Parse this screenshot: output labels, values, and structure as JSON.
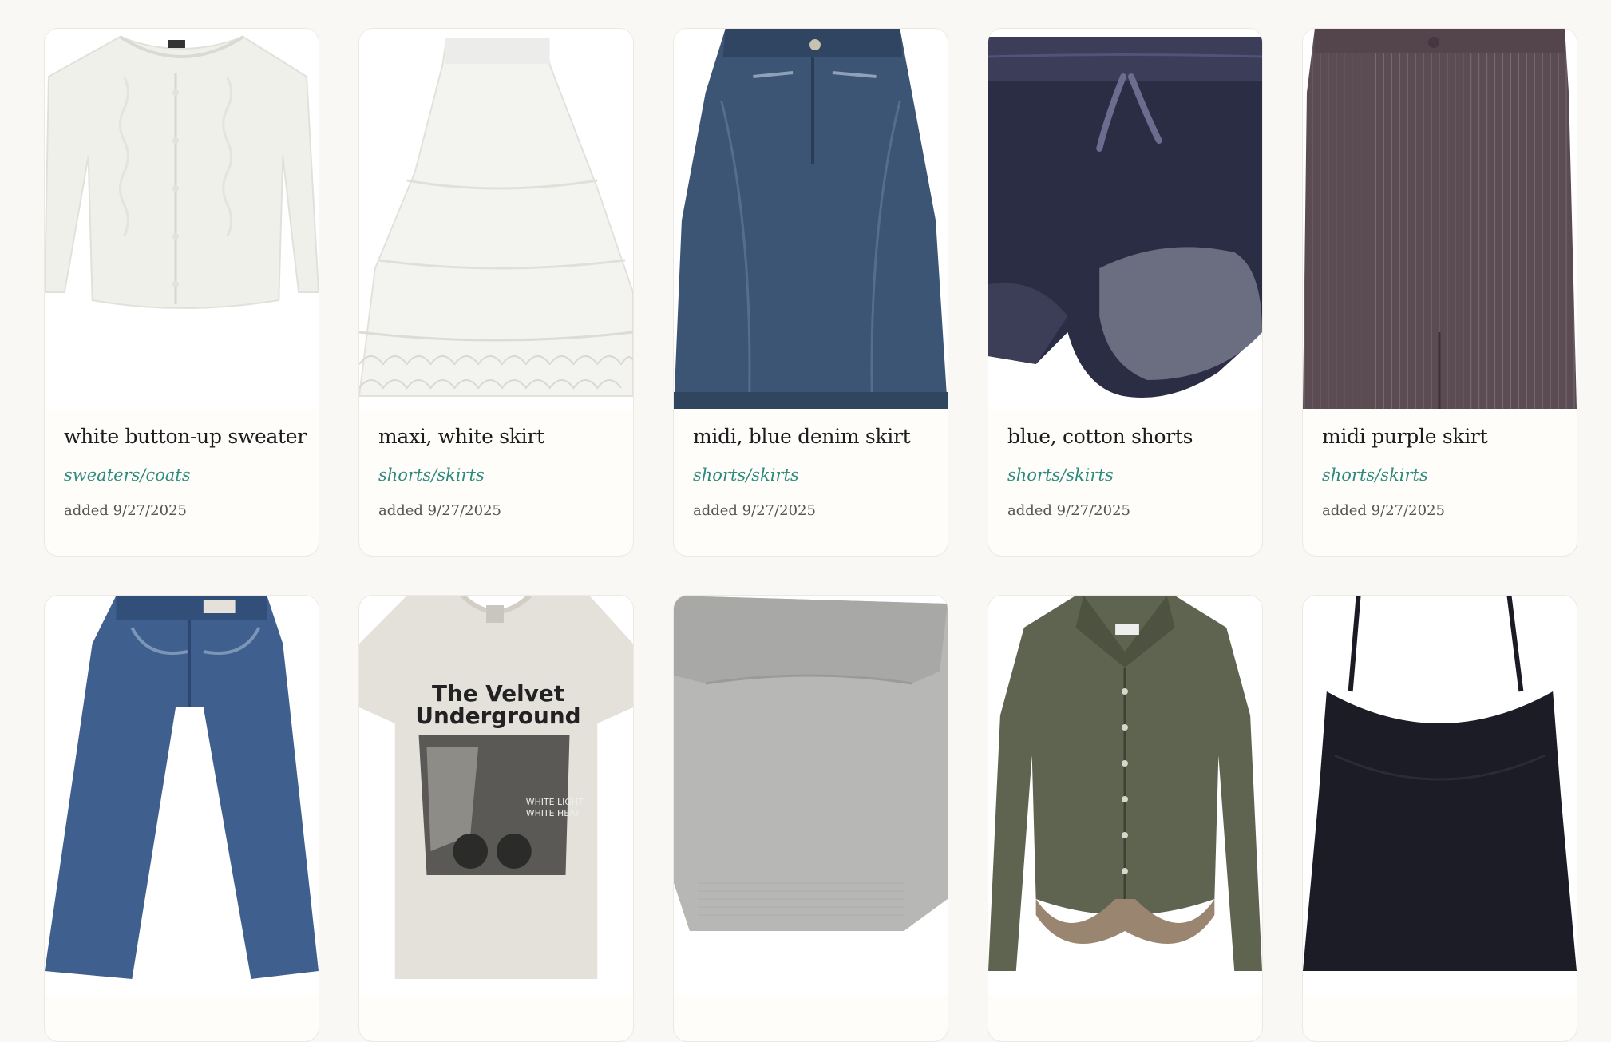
{
  "items": [
    {
      "title": "white button-up sweater",
      "category": "sweaters/coats",
      "date": "added 9/27/2025",
      "icon": "sweater-photo"
    },
    {
      "title": "maxi, white skirt",
      "category": "shorts/skirts",
      "date": "added 9/27/2025",
      "icon": "skirt-photo"
    },
    {
      "title": "midi, blue denim skirt",
      "category": "shorts/skirts",
      "date": "added 9/27/2025",
      "icon": "denim-skirt-photo"
    },
    {
      "title": "blue, cotton shorts",
      "category": "shorts/skirts",
      "date": "added 9/27/2025",
      "icon": "shorts-photo"
    },
    {
      "title": "midi purple skirt",
      "category": "shorts/skirts",
      "date": "added 9/27/2025",
      "icon": "pinstripe-skirt-photo"
    }
  ],
  "items_row2": [
    {
      "icon": "jeans-photo"
    },
    {
      "icon": "band-tee-photo",
      "print_text_1": "The Velvet",
      "print_text_2": "Underground",
      "print_text_3": "WHITE LIGHT",
      "print_text_4": "WHITE HEAT"
    },
    {
      "icon": "grey-knit-photo"
    },
    {
      "icon": "denim-shirt-photo"
    },
    {
      "icon": "black-camisole-photo"
    }
  ],
  "colors": {
    "background": "#faf8f5",
    "accent": "#2c8a7e",
    "card": "#fffdfa"
  }
}
